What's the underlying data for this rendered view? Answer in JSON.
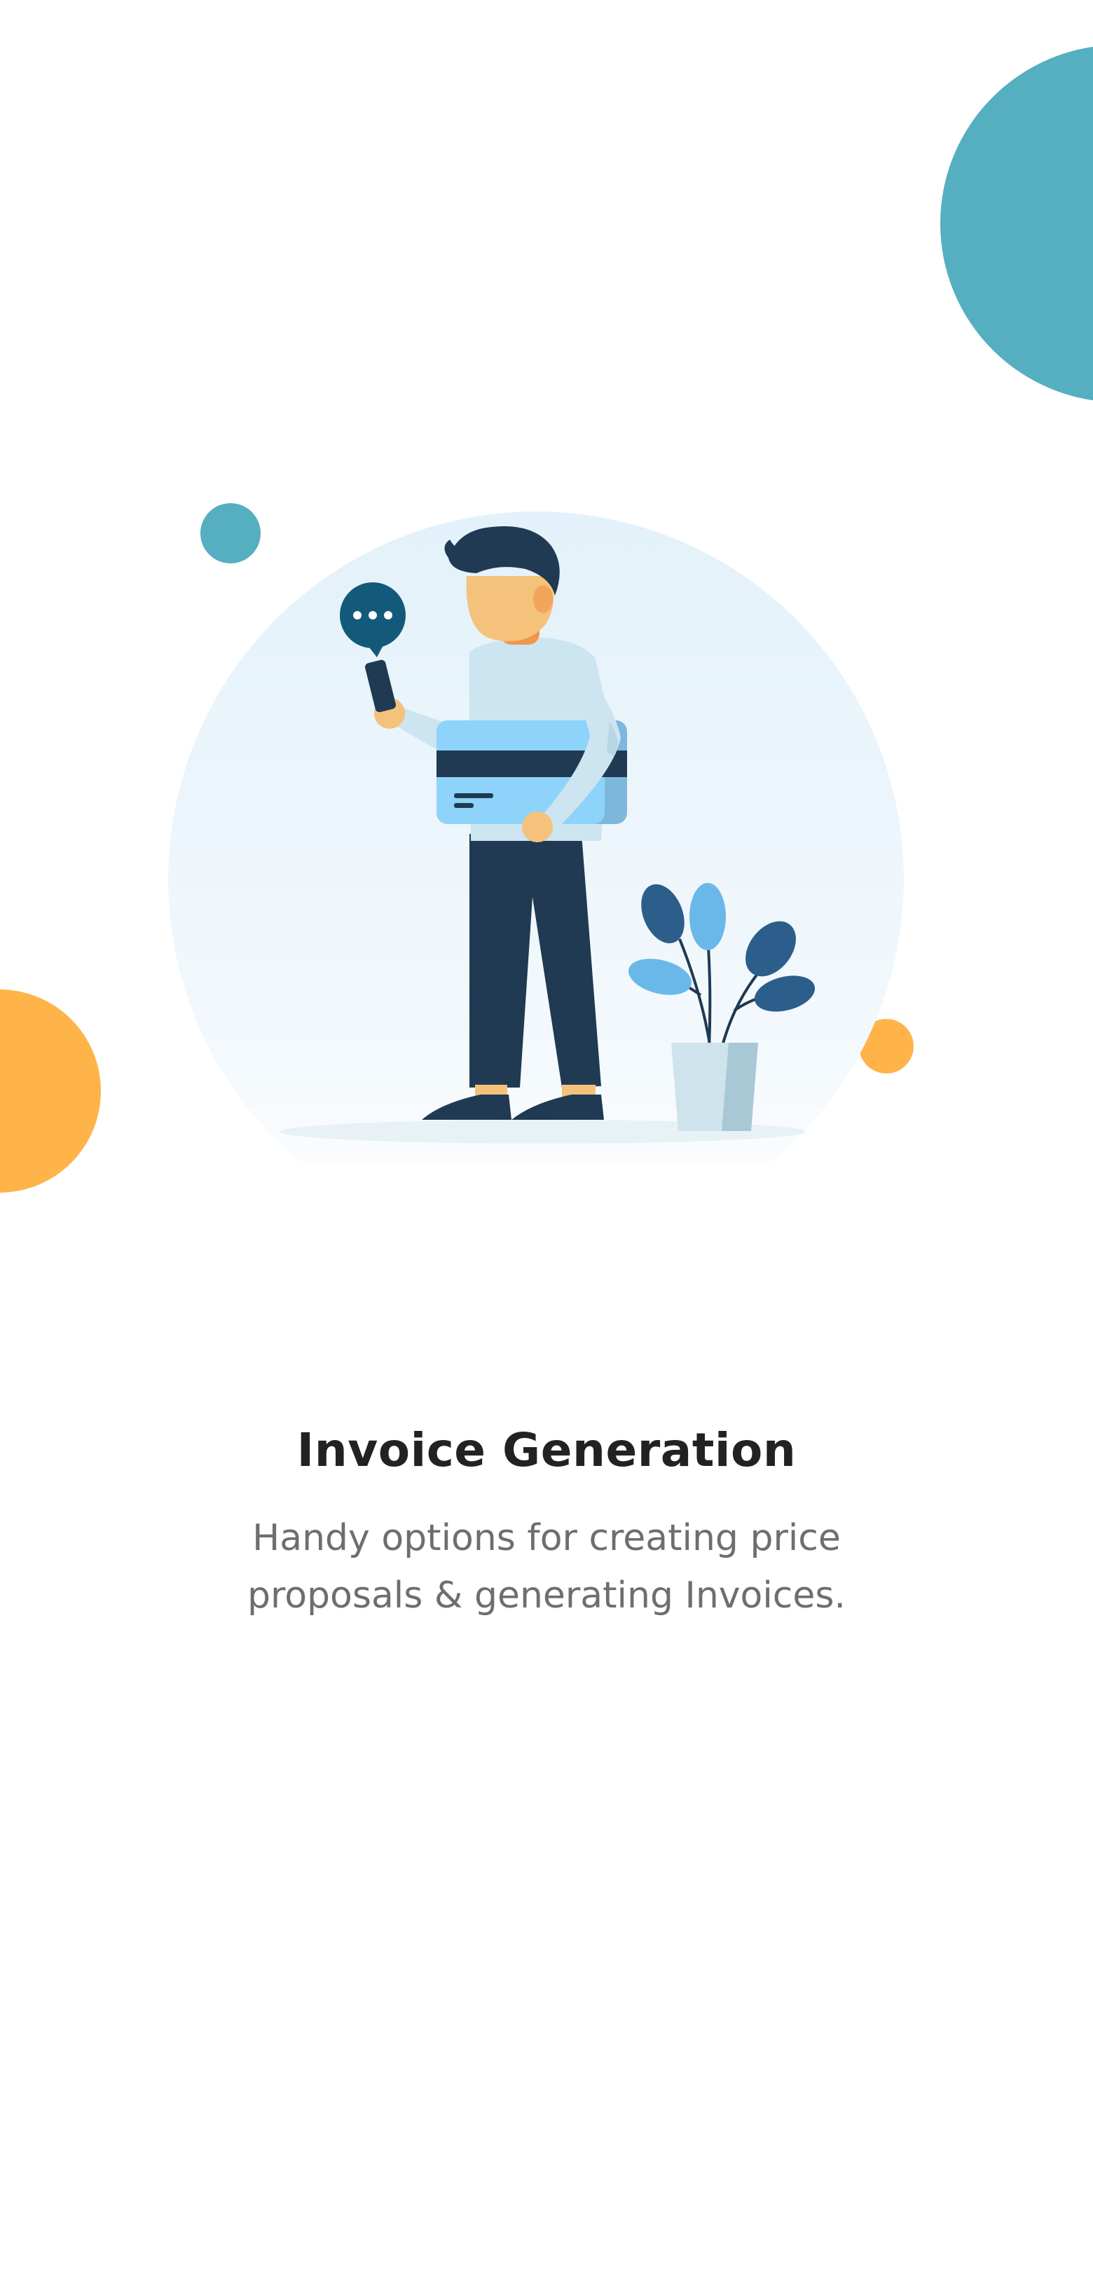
{
  "colors": {
    "background": "#FFFFFF",
    "teal": "#56AFC0",
    "orange": "#FFB44A",
    "title_text": "#222222",
    "subtitle_text": "#6E6E6E",
    "navy": "#1F3A52",
    "light_blue": "#8DD3FA",
    "skin": "#F4C27A"
  },
  "illustration": {
    "chat_bubble_icon": "chat-bubble-ellipsis-icon",
    "subject": "person-holding-credit-card-and-phone",
    "plant": "potted-plant"
  },
  "onboarding": {
    "title": "Invoice Generation",
    "subtitle_line1": "Handy options for creating price",
    "subtitle_line2": "proposals & generating Invoices."
  }
}
